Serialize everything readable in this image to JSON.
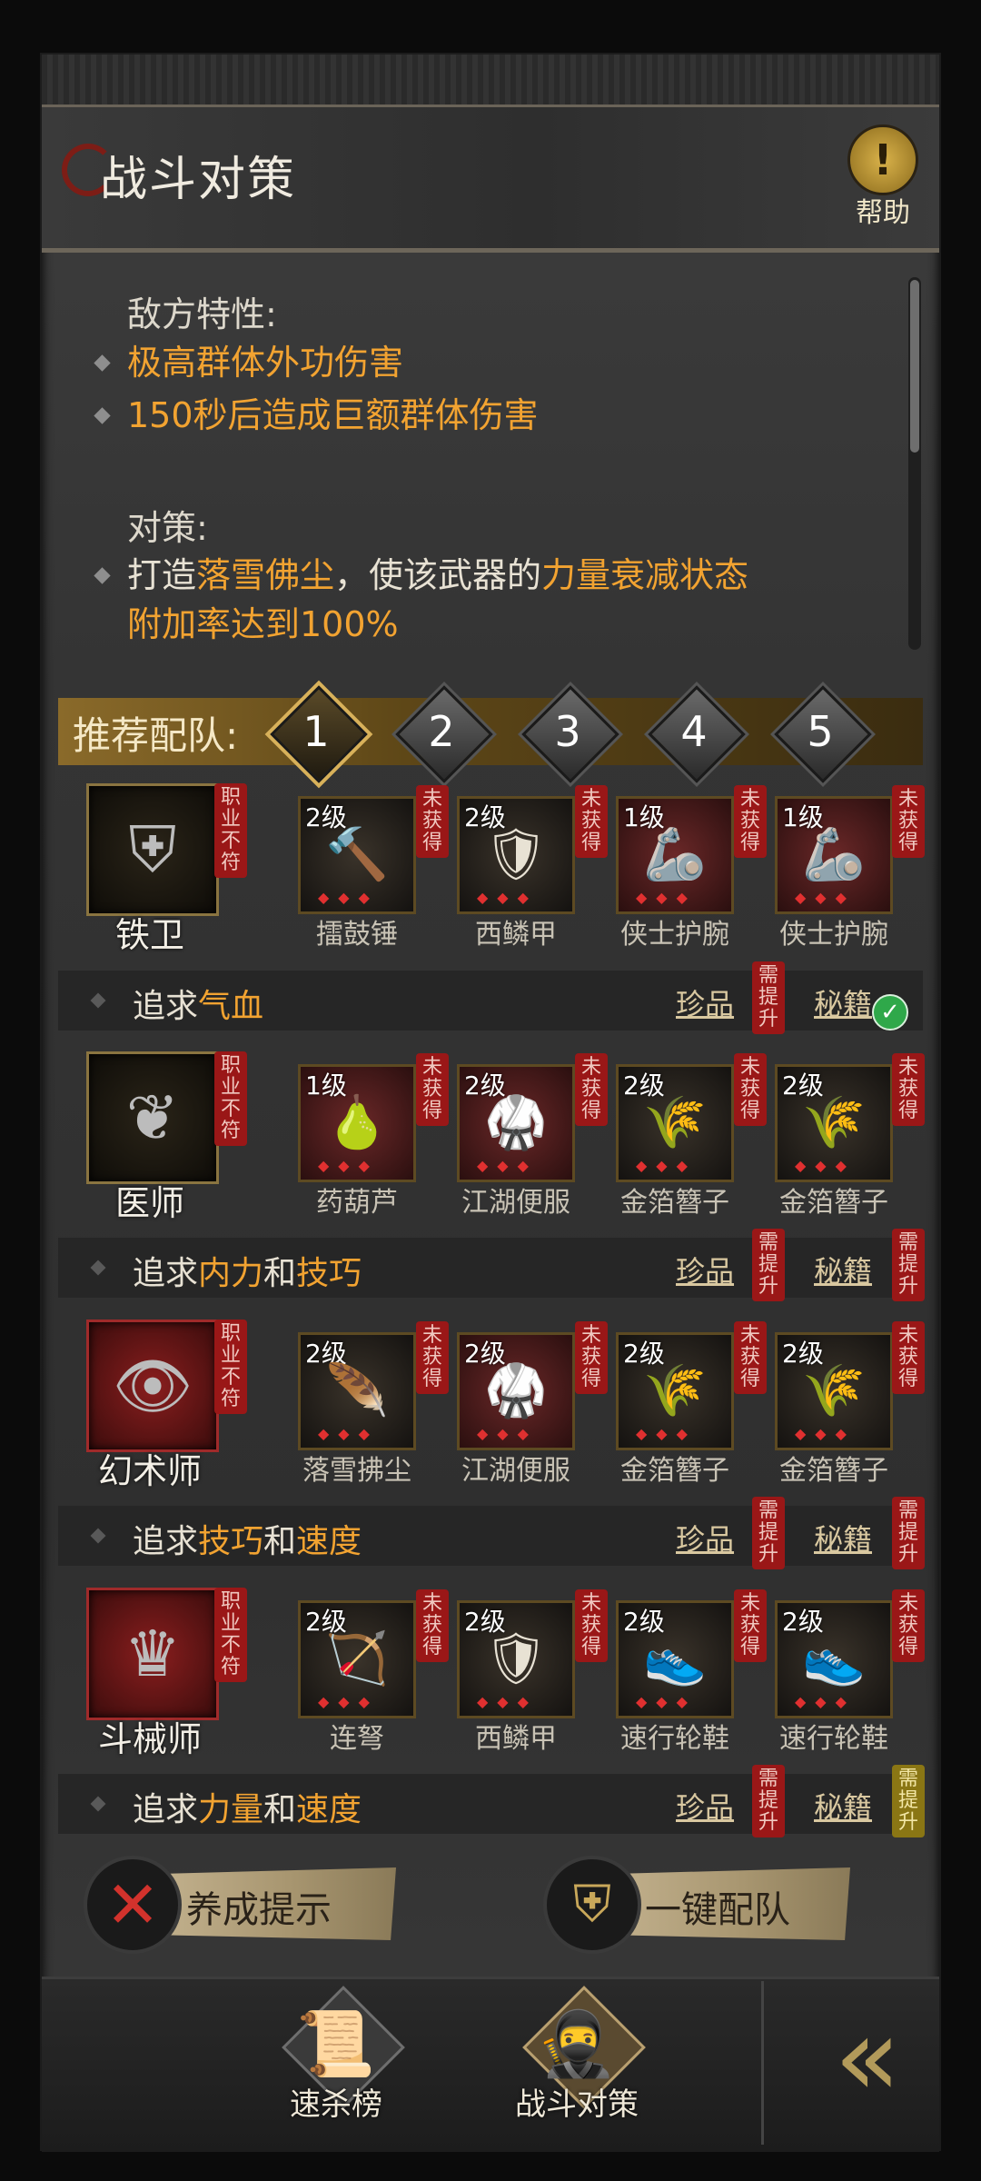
{
  "header": {
    "title": "战斗对策",
    "help_label": "帮助"
  },
  "enemy": {
    "label": "敌方特性:",
    "traits": [
      "极高群体外功伤害",
      "150秒后造成巨额群体伤害"
    ]
  },
  "strategy": {
    "label": "对策:",
    "text_1": "打造",
    "weapon": "落雪佛尘",
    "text_2": "，使该武器的",
    "status": "力量衰减状态",
    "line2": "附加率达到100%"
  },
  "recommend": {
    "label": "推荐配队:",
    "tabs": [
      "1",
      "2",
      "3",
      "4",
      "5"
    ],
    "active_tab": "1"
  },
  "mismatch_tag": "职业不符",
  "not_obtained_tag": "未获得",
  "need_upgrade_tag": "需提升",
  "rows": [
    {
      "class_name": "铁卫",
      "class_icon": "shield-emblem-icon",
      "items": [
        {
          "level": "2级",
          "name": "擂鼓锤",
          "icon": "drum-hammer-icon"
        },
        {
          "level": "2级",
          "name": "西鳞甲",
          "icon": "scale-armor-icon"
        },
        {
          "level": "1级",
          "name": "侠士护腕",
          "icon": "bracer-icon"
        },
        {
          "level": "1级",
          "name": "侠士护腕",
          "icon": "bracer-icon"
        }
      ],
      "pursue_prefix": "追求",
      "pursue_a": "气血",
      "pursue_mid": "",
      "pursue_b": "",
      "link_1": "珍品",
      "link_2": "秘籍"
    },
    {
      "class_name": "医师",
      "class_icon": "leaf-emblem-icon",
      "items": [
        {
          "level": "1级",
          "name": "药葫芦",
          "icon": "gourd-icon"
        },
        {
          "level": "2级",
          "name": "江湖便服",
          "icon": "robe-icon"
        },
        {
          "level": "2级",
          "name": "金箔簪子",
          "icon": "hairpin-icon"
        },
        {
          "level": "2级",
          "name": "金箔簪子",
          "icon": "hairpin-icon"
        }
      ],
      "pursue_prefix": "追求",
      "pursue_a": "内力",
      "pursue_mid": "和",
      "pursue_b": "技巧",
      "link_1": "珍品",
      "link_2": "秘籍"
    },
    {
      "class_name": "幻术师",
      "class_icon": "eye-emblem-icon",
      "items": [
        {
          "level": "2级",
          "name": "落雪拂尘",
          "icon": "whisk-icon"
        },
        {
          "level": "2级",
          "name": "江湖便服",
          "icon": "robe-icon"
        },
        {
          "level": "2级",
          "name": "金箔簪子",
          "icon": "hairpin-icon"
        },
        {
          "level": "2级",
          "name": "金箔簪子",
          "icon": "hairpin-icon"
        }
      ],
      "pursue_prefix": "追求",
      "pursue_a": "技巧",
      "pursue_mid": "和",
      "pursue_b": "速度",
      "link_1": "珍品",
      "link_2": "秘籍"
    },
    {
      "class_name": "斗械师",
      "class_icon": "gear-emblem-icon",
      "items": [
        {
          "level": "2级",
          "name": "连弩",
          "icon": "crossbow-icon"
        },
        {
          "level": "2级",
          "name": "西鳞甲",
          "icon": "scale-armor-icon"
        },
        {
          "level": "2级",
          "name": "速行轮鞋",
          "icon": "wheel-shoes-icon"
        },
        {
          "level": "2级",
          "name": "速行轮鞋",
          "icon": "wheel-shoes-icon"
        }
      ],
      "pursue_prefix": "追求",
      "pursue_a": "力量",
      "pursue_mid": "和",
      "pursue_b": "速度",
      "link_1": "珍品",
      "link_2": "秘籍"
    }
  ],
  "buttons": {
    "hint": "养成提示",
    "auto_team": "一键配队"
  },
  "nav": {
    "speed_rank": "速杀榜",
    "battle_strategy": "战斗对策"
  },
  "colors": {
    "accent": "#f2a331",
    "tag_red": "#9a1717",
    "tag_yellow": "#8a7614",
    "gold": "#d8b15a"
  }
}
